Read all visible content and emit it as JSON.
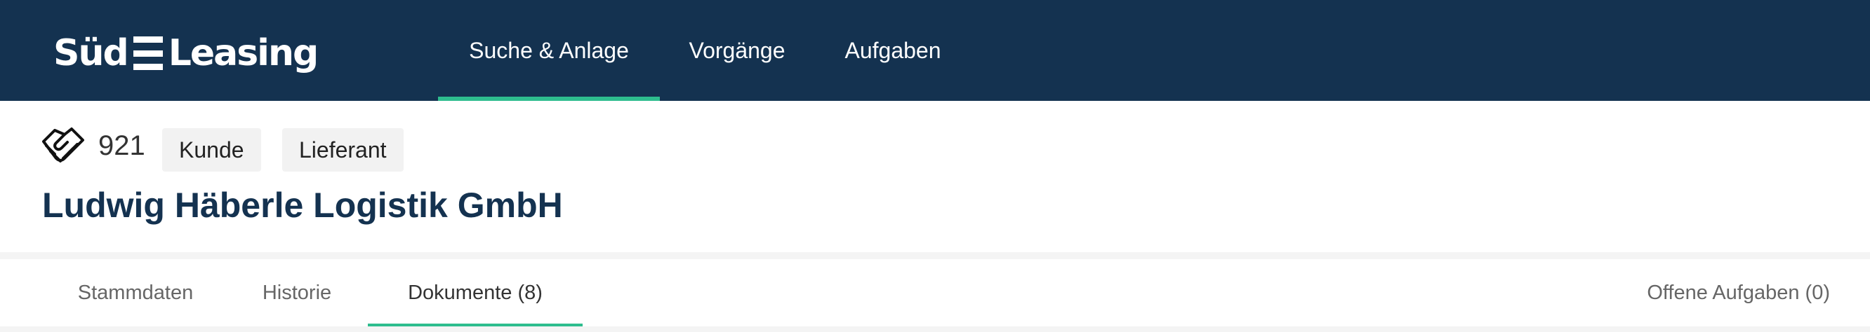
{
  "brand": {
    "left": "Süd",
    "right": "Leasing"
  },
  "nav": {
    "items": [
      {
        "label": "Suche & Anlage",
        "active": true
      },
      {
        "label": "Vorgänge",
        "active": false
      },
      {
        "label": "Aufgaben",
        "active": false
      }
    ]
  },
  "customer": {
    "icon": "handshake-icon",
    "number": "921",
    "tags": [
      "Kunde",
      "Lieferant"
    ],
    "name": "Ludwig Häberle Logistik GmbH"
  },
  "tabs": {
    "items": [
      {
        "label": "Stammdaten",
        "active": false
      },
      {
        "label": "Historie",
        "active": false
      },
      {
        "label": "Dokumente (8)",
        "active": true
      }
    ],
    "open_tasks": "Offene Aufgaben (0)"
  },
  "colors": {
    "header_bg": "#143250",
    "accent": "#2ebd8e",
    "title": "#143250"
  }
}
